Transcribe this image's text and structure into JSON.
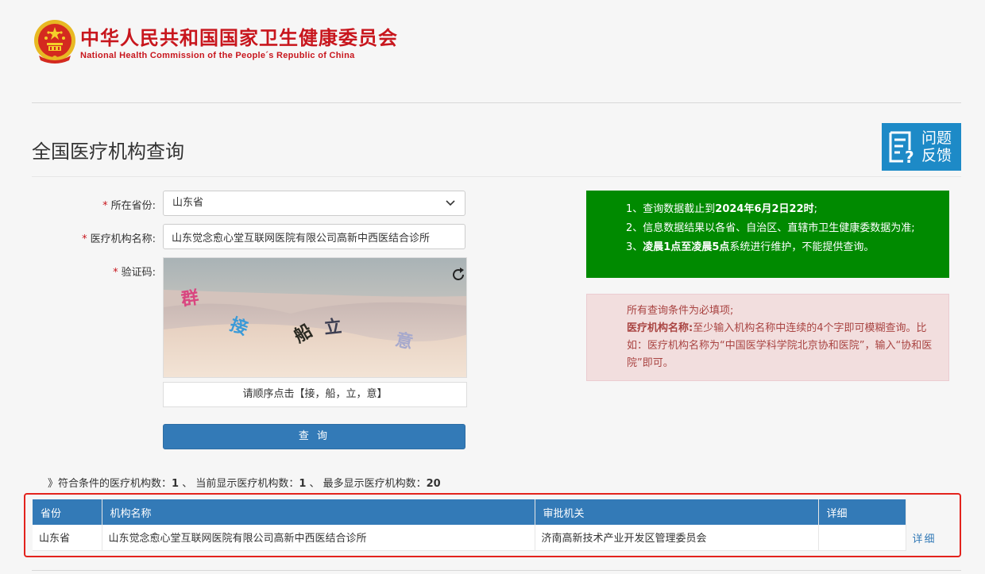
{
  "header": {
    "org_name_cn": "中华人民共和国国家卫生健康委员会",
    "org_name_en": "National Health Commission of the People´s Republic of China"
  },
  "page": {
    "title": "全国医疗机构查询",
    "feedback_line1": "问题",
    "feedback_line2": "反馈"
  },
  "form": {
    "required_mark": "*",
    "province_label": "所在省份:",
    "province_value": "山东省",
    "institution_label": "医疗机构名称:",
    "institution_value": "山东觉念愈心堂互联网医院有限公司高新中西医结合诊所",
    "captcha_label": "验证码:",
    "captcha_chars": [
      "群",
      "接",
      "船",
      "立",
      "意"
    ],
    "captcha_hint": "请顺序点击【接，船，立，意】",
    "submit_label": "查 询"
  },
  "notice_green": {
    "line1_prefix": "1、查询数据截止到",
    "line1_bold": "2024年6月2日22时",
    "line1_suffix": ";",
    "line2": "2、信息数据结果以各省、自治区、直辖市卫生健康委数据为准;",
    "line3_prefix": "3、",
    "line3_bold": "凌晨1点至凌晨5点",
    "line3_suffix": "系统进行维护，不能提供查询。"
  },
  "notice_red": {
    "line1": "所有查询条件为必填项;",
    "line2_bold": "医疗机构名称:",
    "line2_rest": "至少输入机构名称中连续的4个字即可模糊查询。比如：医疗机构名称为“中国医学科学院北京协和医院”，输入“协和医院”即可。"
  },
  "summary": {
    "prefix": "》符合条件的医疗机构数：",
    "total": "1",
    "sep1": " 、 当前显示医疗机构数：",
    "shown": "1",
    "sep2": " 、 最多显示医疗机构数：",
    "max": "20"
  },
  "results": {
    "headers": [
      "省份",
      "机构名称",
      "审批机关",
      "详细"
    ],
    "rows": [
      {
        "province": "山东省",
        "name": "山东觉念愈心堂互联网医院有限公司高新中西医结合诊所",
        "authority": "济南高新技术产业开发区管理委员会",
        "detail": "",
        "link": "详细"
      }
    ]
  },
  "colors": {
    "brand_red": "#c8161d",
    "primary_blue": "#337ab7",
    "notice_green": "#008a00",
    "notice_red_bg": "#f2dede",
    "highlight_border": "#e3231d"
  }
}
